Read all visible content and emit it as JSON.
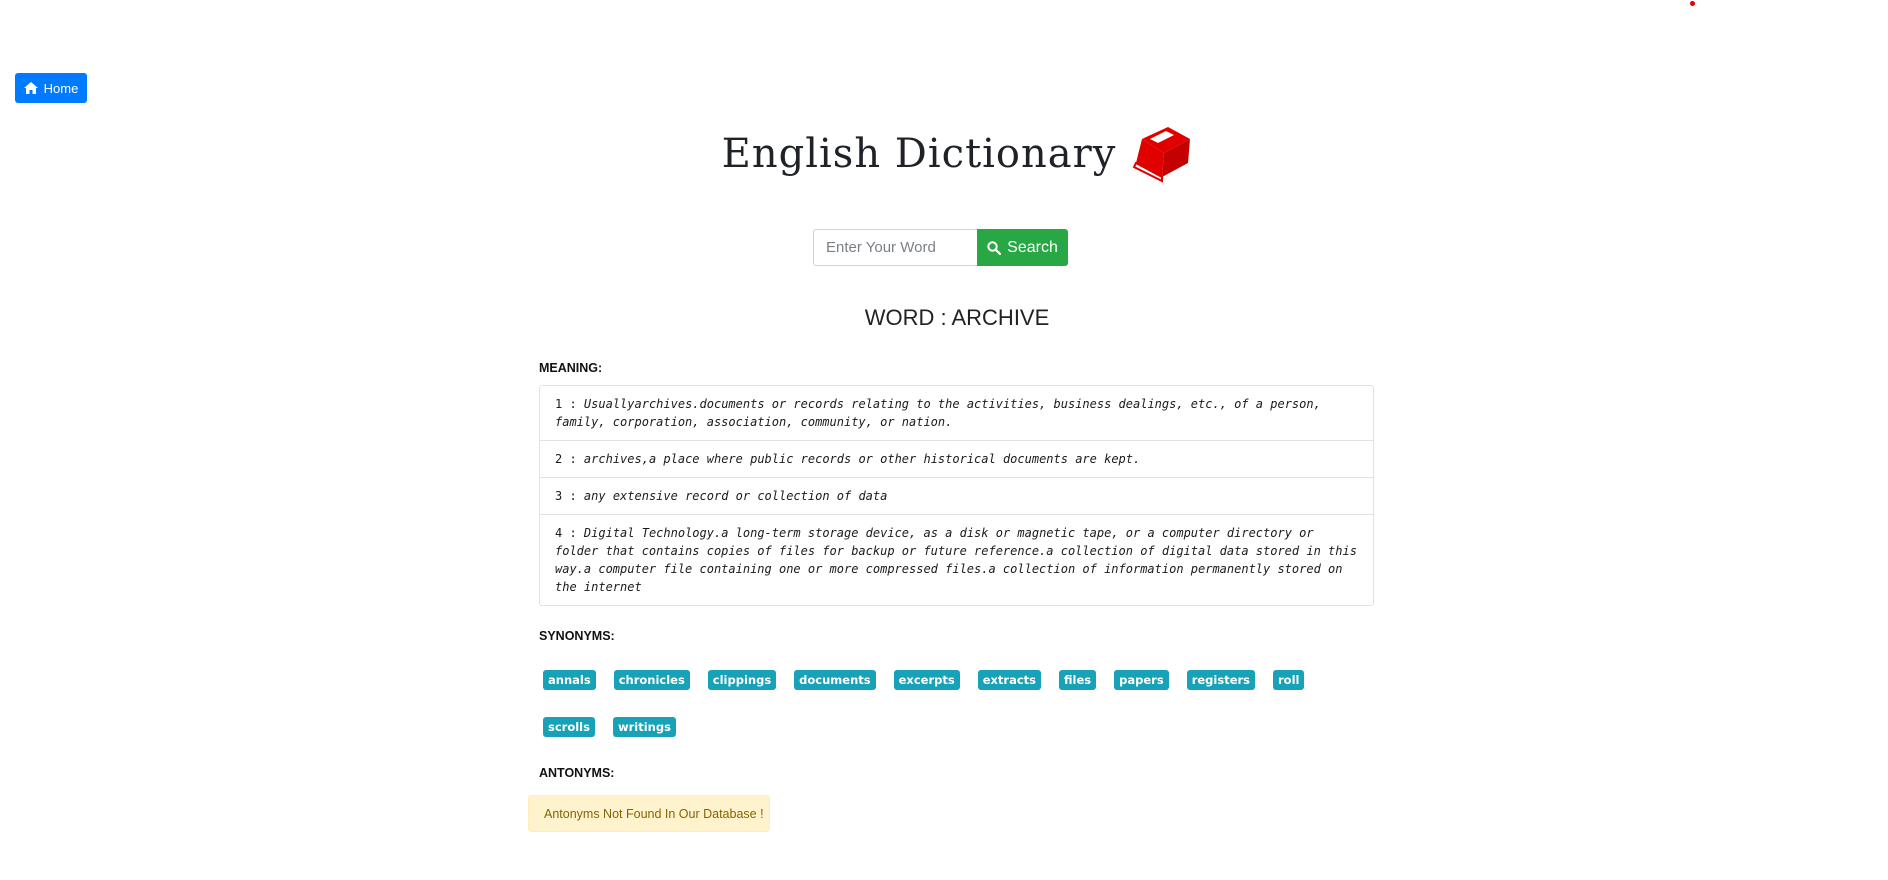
{
  "nav": {
    "home_label": "Home"
  },
  "header": {
    "title": "English Dictionary"
  },
  "search": {
    "placeholder": "Enter Your Word",
    "button_label": "Search"
  },
  "word": {
    "heading": "WORD : ARCHIVE"
  },
  "meaning": {
    "label": "MEANING:",
    "items": [
      {
        "num": "1 :",
        "text": "Usuallyarchives.documents or records relating to the activities, business dealings, etc., of a person, family, corporation, association, community, or nation."
      },
      {
        "num": "2 :",
        "text": "archives,a place where public records or other historical documents are kept."
      },
      {
        "num": "3 :",
        "text": "any extensive record or collection of data"
      },
      {
        "num": "4 :",
        "text": "Digital Technology.a long-term storage device, as a disk or magnetic tape, or a computer directory or folder that contains copies of files for backup or future reference.a collection of digital data stored in this way.a computer file containing one or more compressed files.a collection of information permanently stored on the internet"
      }
    ]
  },
  "synonyms": {
    "label": "SYNONYMS:",
    "items": [
      "annals",
      "chronicles",
      "clippings",
      "documents",
      "excerpts",
      "extracts",
      "files",
      "papers",
      "registers",
      "roll",
      "scrolls",
      "writings"
    ]
  },
  "antonyms": {
    "label": "ANTONYMS:",
    "message": "Antonyms Not Found In Our Database !"
  },
  "colors": {
    "primary": "#007bff",
    "success": "#28a745",
    "info": "#17a2b8",
    "warning_bg": "#fff3cd",
    "book_red": "#e00000"
  }
}
